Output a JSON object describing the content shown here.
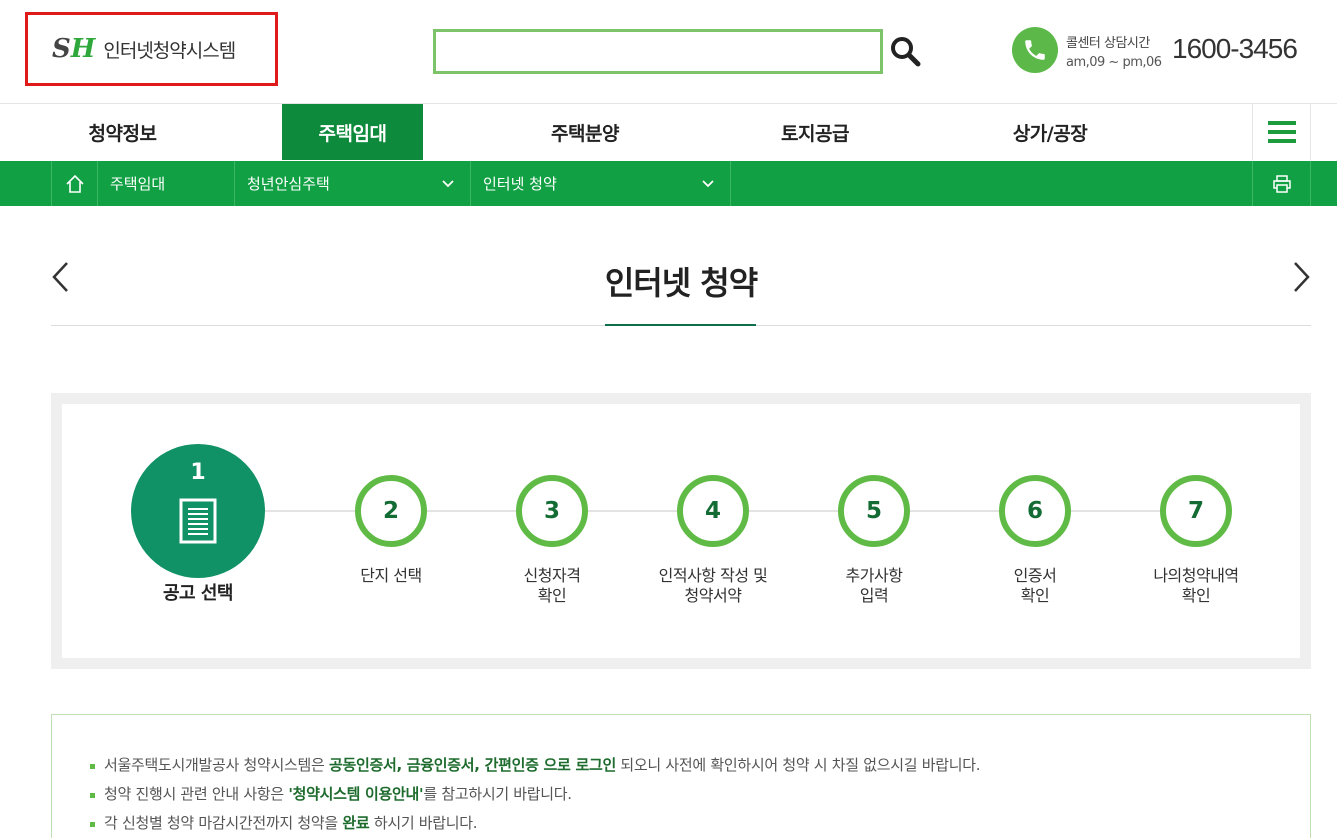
{
  "header": {
    "logo_mark_s": "S",
    "logo_mark_h": "H",
    "logo_text": "인터넷청약시스템",
    "search_value": "",
    "callcenter_label": "콜센터 상담시간",
    "callcenter_hours": "am,09 ~ pm,06",
    "phone_number": "1600-3456"
  },
  "gnb": {
    "items": [
      {
        "label": "청약정보"
      },
      {
        "label": "주택임대"
      },
      {
        "label": "주택분양"
      },
      {
        "label": "토지공급"
      },
      {
        "label": "상가/공장"
      }
    ],
    "active_index": 1
  },
  "breadcrumb": {
    "level1": "주택임대",
    "level2": "청년안심주택",
    "level3": "인터넷 청약"
  },
  "page": {
    "title": "인터넷 청약"
  },
  "steps": [
    {
      "number": "1",
      "label_line1": "공고 선택",
      "label_line2": ""
    },
    {
      "number": "2",
      "label_line1": "단지 선택",
      "label_line2": ""
    },
    {
      "number": "3",
      "label_line1": "신청자격",
      "label_line2": "확인"
    },
    {
      "number": "4",
      "label_line1": "인적사항 작성 및",
      "label_line2": "청약서약"
    },
    {
      "number": "5",
      "label_line1": "추가사항",
      "label_line2": "입력"
    },
    {
      "number": "6",
      "label_line1": "인증서",
      "label_line2": "확인"
    },
    {
      "number": "7",
      "label_line1": "나의청약내역",
      "label_line2": "확인"
    }
  ],
  "notice": {
    "line1_a": "서울주택도시개발공사 청약시스템은 ",
    "line1_b": "공동인증서, 금융인증서, 간편인증 으로 로그인",
    "line1_c": " 되오니 사전에 확인하시어 청약 시 차질 없으시길 바랍니다.",
    "line2_a": "청약 진행시 관련 안내 사항은 ",
    "line2_b": "'청약시스템 이용안내'",
    "line2_c": "를 참고하시기 바랍니다.",
    "line3_a": "각 신청별 청약 마감시간전까지 청약을 ",
    "line3_b": "완료",
    "line3_c": " 하시기 바랍니다."
  },
  "colors": {
    "brand_green": "#11a043",
    "gnb_active": "#0d8a3b",
    "step_active": "#109166",
    "step_ring": "#60bb46",
    "logo_highlight_border": "#e01919"
  },
  "icons": [
    "search-icon",
    "phone-icon",
    "menu-icon",
    "home-icon",
    "chevron-down-icon",
    "print-icon",
    "chevron-left-icon",
    "chevron-right-icon",
    "document-icon"
  ]
}
